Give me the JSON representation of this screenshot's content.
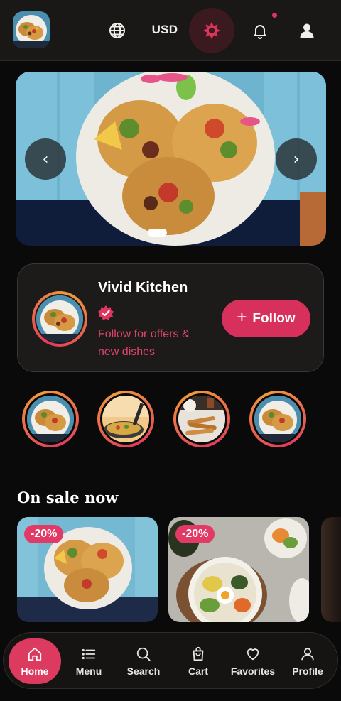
{
  "header": {
    "logo_alt": "Vivid Kitchen logo",
    "currency": "USD",
    "icons": {
      "language": "globe-icon",
      "theme": "sun-icon",
      "notifications": "bell-icon",
      "account": "user-icon"
    },
    "accent_color": "#e0355f"
  },
  "hero": {
    "prev_label": "‹",
    "next_label": "›",
    "slide_count": 1,
    "active_slide": 1
  },
  "follow_card": {
    "name": "Vivid Kitchen",
    "verified_icon": "verified-badge-icon",
    "subtitle": "Follow for offers & new dishes",
    "button_label": "Follow",
    "button_icon": "plus-icon",
    "button_color": "#d8305c"
  },
  "stories": [
    {
      "name": "tacos-story"
    },
    {
      "name": "paella-story"
    },
    {
      "name": "churros-story"
    },
    {
      "name": "tacos-story-2"
    }
  ],
  "sale": {
    "title": "On sale now",
    "items": [
      {
        "badge": "-20%",
        "dish": "tacos"
      },
      {
        "badge": "-20%",
        "dish": "bibimbap"
      }
    ]
  },
  "bottom_nav": {
    "items": [
      {
        "label": "Home",
        "icon": "home-icon",
        "active": true
      },
      {
        "label": "Menu",
        "icon": "list-icon",
        "active": false
      },
      {
        "label": "Search",
        "icon": "search-icon",
        "active": false
      },
      {
        "label": "Cart",
        "icon": "shopping-bag-icon",
        "active": false
      },
      {
        "label": "Favorites",
        "icon": "heart-icon",
        "active": false
      },
      {
        "label": "Profile",
        "icon": "user-icon",
        "active": false
      }
    ],
    "active_color": "#dc3a5e"
  }
}
